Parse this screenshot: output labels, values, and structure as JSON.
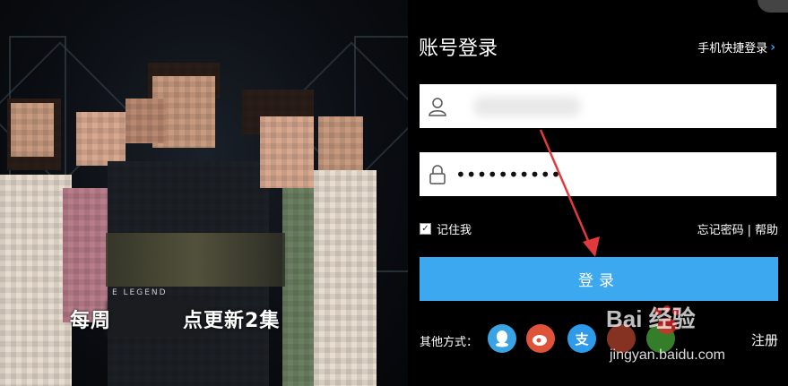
{
  "banner": {
    "caption_left": "每周",
    "caption_right": "点更新2集",
    "legend_text": "E LEGEND"
  },
  "login": {
    "title": "账号登录",
    "phone_link": "手机快捷登录",
    "username_value": "",
    "password_value": "••••••••••",
    "remember_label": "记住我",
    "remember_checked": true,
    "forgot_label": "忘记密码",
    "separator": "|",
    "help_label": "帮助",
    "submit_label": "登录",
    "other_label": "其他方式：",
    "register_label": "注册",
    "accent_color": "#3ba8ef"
  },
  "social": [
    {
      "name": "qq-icon",
      "glyph": "🐧",
      "color": "#3aa3e3"
    },
    {
      "name": "weibo-icon",
      "glyph": "微",
      "color": "#e0533b"
    },
    {
      "name": "alipay-icon",
      "glyph": "支",
      "color": "#2e9bea"
    },
    {
      "name": "baidu-icon",
      "glyph": "百",
      "color": "#e0533b"
    },
    {
      "name": "wechat-icon",
      "glyph": "✓",
      "color": "#4ab43a"
    }
  ],
  "watermark": {
    "logo": "Bai  经验",
    "url": "jingyan.baidu.com"
  }
}
